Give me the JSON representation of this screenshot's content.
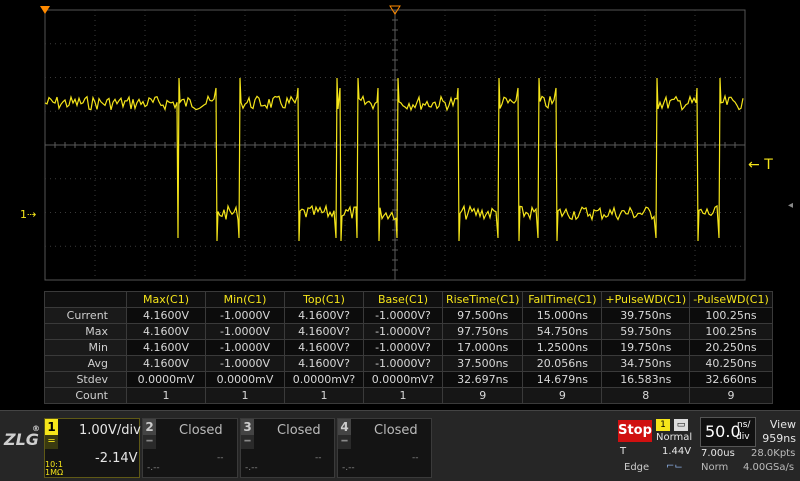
{
  "colors": {
    "ch1": "#f5e51a",
    "grid": "#5a5a5a",
    "stop": "#d01010"
  },
  "waveform": {
    "high_level_v": 4.16,
    "low_level_v": -1.0,
    "edges": [
      [
        178,
        "r"
      ],
      [
        216,
        "f"
      ],
      [
        239,
        "r"
      ],
      [
        298,
        "f"
      ],
      [
        336,
        "r"
      ],
      [
        340,
        "f"
      ],
      [
        357,
        "r"
      ],
      [
        378,
        "f"
      ],
      [
        397,
        "r"
      ],
      [
        458,
        "f"
      ],
      [
        498,
        "r"
      ],
      [
        518,
        "f"
      ],
      [
        538,
        "r"
      ],
      [
        556,
        "f"
      ],
      [
        656,
        "r"
      ],
      [
        697,
        "f"
      ],
      [
        719,
        "r"
      ]
    ],
    "start_level": "high"
  },
  "trigger_marker": {
    "label": "T",
    "arrow": "←"
  },
  "ch1_marker": {
    "label": "1"
  },
  "measurements": {
    "columns": [
      "",
      "Max(C1)",
      "Min(C1)",
      "Top(C1)",
      "Base(C1)",
      "RiseTime(C1)",
      "FallTime(C1)",
      "+PulseWD(C1)",
      "-PulseWD(C1)"
    ],
    "rows": [
      [
        "Current",
        "4.1600V",
        "-1.0000V",
        "4.1600V?",
        "-1.0000V?",
        "97.500ns",
        "15.000ns",
        "39.750ns",
        "100.25ns"
      ],
      [
        "Max",
        "4.1600V",
        "-1.0000V",
        "4.1600V?",
        "-1.0000V?",
        "97.750ns",
        "54.750ns",
        "59.750ns",
        "100.25ns"
      ],
      [
        "Min",
        "4.1600V",
        "-1.0000V",
        "4.1600V?",
        "-1.0000V?",
        "17.000ns",
        "1.2500ns",
        "19.750ns",
        "20.250ns"
      ],
      [
        "Avg",
        "4.1600V",
        "-1.0000V",
        "4.1600V?",
        "-1.0000V?",
        "37.500ns",
        "20.056ns",
        "34.750ns",
        "40.250ns"
      ],
      [
        "Stdev",
        "0.0000mV",
        "0.0000mV",
        "0.0000mV?",
        "0.0000mV?",
        "32.697ns",
        "14.679ns",
        "16.583ns",
        "32.660ns"
      ],
      [
        "Count",
        "1",
        "1",
        "1",
        "1",
        "9",
        "9",
        "8",
        "9"
      ]
    ]
  },
  "logo": {
    "text": "ZLG",
    "reg": "®"
  },
  "channels": {
    "ch1": {
      "num": "1",
      "scale": "1.00V/div",
      "offset": "-2.14V",
      "coupling_top": "10:1",
      "coupling_bottom": "1MΩ"
    },
    "ch2": {
      "num": "2",
      "status": "Closed",
      "left": "-.--",
      "right": "--"
    },
    "ch3": {
      "num": "3",
      "status": "Closed",
      "left": "-.--",
      "right": "--"
    },
    "ch4": {
      "num": "4",
      "status": "Closed",
      "left": "-.--",
      "right": "--"
    }
  },
  "acquisition": {
    "run_state": "Stop",
    "trigger_source": "1",
    "trigger_mode": "Normal",
    "trigger_label": "T",
    "trigger_level": "1.44V",
    "trigger_type": "Edge"
  },
  "timebase": {
    "value": "50.0",
    "unit_top": "ns/",
    "unit_bottom": "div",
    "delay": "7.00us",
    "mode": "Norm",
    "memory": "28.0Kpts",
    "sample_rate": "4.00GSa/s",
    "view_label": "View",
    "view_points": "959ns"
  }
}
